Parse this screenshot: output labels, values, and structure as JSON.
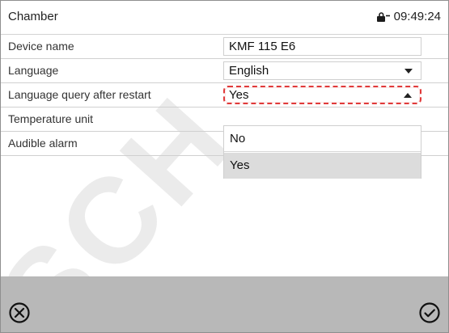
{
  "header": {
    "title": "Chamber",
    "time": "09:49:24"
  },
  "rows": [
    {
      "label": "Device name",
      "value": "KMF 115 E6",
      "type": "text"
    },
    {
      "label": "Language",
      "value": "English",
      "type": "select"
    },
    {
      "label": "Language query after restart",
      "value": "Yes",
      "type": "select-active"
    },
    {
      "label": "Temperature unit",
      "value": "",
      "type": "empty"
    },
    {
      "label": "Audible alarm",
      "value": "",
      "type": "empty"
    }
  ],
  "dropdown": {
    "options": [
      "No",
      "Yes"
    ],
    "selected": "Yes"
  },
  "icons": {
    "lock": "lock-icon",
    "cancel": "close-circle-icon",
    "confirm": "check-circle-icon"
  },
  "colors": {
    "highlight": "#e03a3a",
    "bottom_bar": "#b8b8b8",
    "selected_option": "#dcdcdc"
  }
}
